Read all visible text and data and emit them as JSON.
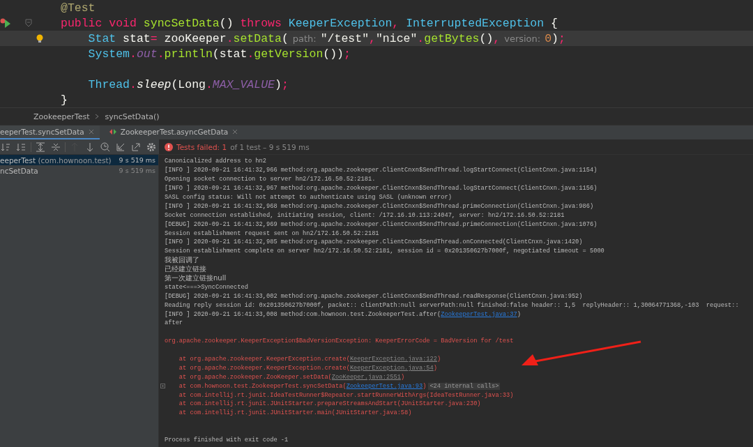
{
  "editor": {
    "lines": [
      {
        "current": false,
        "kind": "plain",
        "tokens": [
          {
            "t": "@Test",
            "kind": "annotation"
          }
        ]
      },
      {
        "current": false,
        "kind": "run",
        "tokens": [
          {
            "t": "public void ",
            "kind": "keyword"
          },
          {
            "t": "syncSetData",
            "kind": "method"
          },
          {
            "t": "() ",
            "kind": "plain"
          },
          {
            "t": "throws ",
            "kind": "keyword"
          },
          {
            "t": "KeeperException",
            "kind": "type"
          },
          {
            "t": ", ",
            "kind": "op"
          },
          {
            "t": "InterruptedException",
            "kind": "type"
          },
          {
            "t": " {",
            "kind": "plain"
          }
        ],
        "children": [
          {
            "current": true,
            "kind": "bulb",
            "tokens": [
              {
                "t": "Stat",
                "kind": "type"
              },
              {
                "t": " stat",
                "kind": "plain"
              },
              {
                "t": "=",
                "kind": "op"
              },
              {
                "t": " zooKeeper",
                "kind": "plain"
              },
              {
                "t": ".",
                "kind": "op"
              },
              {
                "t": "setData",
                "kind": "method"
              },
              {
                "t": "(",
                "kind": "plain"
              },
              {
                "t": "path:",
                "kind": "hint"
              },
              {
                "t": "\"/test\"",
                "kind": "string"
              },
              {
                "t": ",",
                "kind": "op"
              },
              {
                "t": "\"nice\"",
                "kind": "string"
              },
              {
                "t": ".",
                "kind": "op"
              },
              {
                "t": "getBytes",
                "kind": "method"
              },
              {
                "t": "()",
                "kind": "plain"
              },
              {
                "t": ",",
                "kind": "op"
              },
              {
                "t": "version:",
                "kind": "hint"
              },
              {
                "t": "0",
                "kind": "number"
              },
              {
                "t": ")",
                "kind": "plain"
              },
              {
                "t": ";",
                "kind": "op"
              }
            ]
          },
          {
            "current": false,
            "kind": "plain",
            "tokens": [
              {
                "t": "System",
                "kind": "type"
              },
              {
                "t": ".",
                "kind": "op"
              },
              {
                "t": "out",
                "kind": "field"
              },
              {
                "t": ".",
                "kind": "op"
              },
              {
                "t": "println",
                "kind": "method"
              },
              {
                "t": "(stat",
                "kind": "plain"
              },
              {
                "t": ".",
                "kind": "op"
              },
              {
                "t": "getVersion",
                "kind": "method"
              },
              {
                "t": "())",
                "kind": "plain"
              },
              {
                "t": ";",
                "kind": "op"
              }
            ]
          },
          {
            "current": false,
            "kind": "plain"
          },
          {
            "current": false,
            "kind": "plain",
            "tokens": [
              {
                "t": "Thread",
                "kind": "type"
              },
              {
                "t": ".",
                "kind": "op"
              },
              {
                "t": "sleep",
                "kind": "static"
              },
              {
                "t": "(Long",
                "kind": "plain"
              },
              {
                "t": ".",
                "kind": "op"
              },
              {
                "t": "MAX_VALUE",
                "kind": "field"
              },
              {
                "t": ")",
                "kind": "plain"
              },
              {
                "t": ";",
                "kind": "op"
              }
            ]
          }
        ]
      },
      {
        "current": false,
        "kind": "plain",
        "tokens": [
          {
            "t": "}",
            "kind": "plain"
          }
        ]
      }
    ]
  },
  "breadcrumbs": [
    "ZookeeperTest",
    "syncSetData()"
  ],
  "run_tabs": [
    {
      "label": "eeperTest.syncSetData",
      "selected": true
    },
    {
      "label": "ZookeeperTest.asyncGetData",
      "selected": false
    }
  ],
  "toolbar": [
    {
      "kind": "sort-alpha",
      "disabled": false
    },
    {
      "kind": "sort-duration",
      "disabled": false
    },
    {
      "kind": "expand",
      "disabled": false
    },
    {
      "kind": "collapse",
      "disabled": false
    },
    {
      "kind": "up",
      "disabled": true
    },
    {
      "kind": "down",
      "disabled": false
    },
    {
      "kind": "history",
      "disabled": false
    },
    {
      "kind": "import",
      "disabled": false
    },
    {
      "kind": "export",
      "disabled": false
    },
    {
      "kind": "settings",
      "disabled": false
    }
  ],
  "test_status": {
    "failed": "Tests failed: 1",
    "rest": "of 1 test – 9 s 519 ms"
  },
  "test_tree": [
    {
      "name": "eeperTest",
      "package": "(com.hownoon.test)",
      "time": "9 s 519 ms",
      "selected": true,
      "children": [
        {
          "name": "ncSetData",
          "time": "9 s 519 ms",
          "selected": false
        }
      ]
    }
  ],
  "console": [
    {
      "kind": "out",
      "segments": [
        {
          "t": "Canonicalized address to hn2",
          "kind": "text"
        }
      ]
    },
    {
      "kind": "out",
      "segments": [
        {
          "t": "[INFO ] 2020-09-21 16:41:32,966 method:org.apache.zookeeper.ClientCnxn$SendThread.logStartConnect(ClientCnxn.java:1154)",
          "kind": "text"
        }
      ]
    },
    {
      "kind": "out",
      "segments": [
        {
          "t": "Opening socket connection to server hn2/172.16.50.52:2181.",
          "kind": "text"
        }
      ]
    },
    {
      "kind": "out",
      "segments": [
        {
          "t": "[INFO ] 2020-09-21 16:41:32,967 method:org.apache.zookeeper.ClientCnxn$SendThread.logStartConnect(ClientCnxn.java:1156)",
          "kind": "text"
        }
      ]
    },
    {
      "kind": "out",
      "segments": [
        {
          "t": "SASL config status: Will not attempt to authenticate using SASL (unknown error)",
          "kind": "text"
        }
      ]
    },
    {
      "kind": "out",
      "segments": [
        {
          "t": "[INFO ] 2020-09-21 16:41:32,968 method:org.apache.zookeeper.ClientCnxn$SendThread.primeConnection(ClientCnxn.java:986)",
          "kind": "text"
        }
      ]
    },
    {
      "kind": "out",
      "segments": [
        {
          "t": "Socket connection established, initiating session, client: /172.16.10.113:24047, server: hn2/172.16.50.52:2181",
          "kind": "text"
        }
      ]
    },
    {
      "kind": "out",
      "segments": [
        {
          "t": "[DEBUG] 2020-09-21 16:41:32,969 method:org.apache.zookeeper.ClientCnxn$SendThread.primeConnection(ClientCnxn.java:1076)",
          "kind": "text"
        }
      ]
    },
    {
      "kind": "out",
      "segments": [
        {
          "t": "Session establishment request sent on hn2/172.16.50.52:2181",
          "kind": "text"
        }
      ]
    },
    {
      "kind": "out",
      "segments": [
        {
          "t": "[INFO ] 2020-09-21 16:41:32,985 method:org.apache.zookeeper.ClientCnxn$SendThread.onConnected(ClientCnxn.java:1420)",
          "kind": "text"
        }
      ]
    },
    {
      "kind": "out",
      "segments": [
        {
          "t": "Session establishment complete on server hn2/172.16.50.52:2181, session id = 0x201350627b7000f, negotiated timeout = 5000",
          "kind": "text"
        }
      ]
    },
    {
      "kind": "out",
      "segments": [
        {
          "t": "我被回调了",
          "kind": "text"
        }
      ]
    },
    {
      "kind": "out",
      "segments": [
        {
          "t": "已经建立链接",
          "kind": "text"
        }
      ]
    },
    {
      "kind": "out",
      "segments": [
        {
          "t": "第一次建立链接null",
          "kind": "text"
        }
      ]
    },
    {
      "kind": "out",
      "segments": [
        {
          "t": "state<===>SyncConnected",
          "kind": "text"
        }
      ]
    },
    {
      "kind": "out",
      "segments": [
        {
          "t": "[DEBUG] 2020-09-21 16:41:33,002 method:org.apache.zookeeper.ClientCnxn$SendThread.readResponse(ClientCnxn.java:952)",
          "kind": "text"
        }
      ]
    },
    {
      "kind": "out",
      "segments": [
        {
          "t": "Reading reply session id: 0x201350627b7000f, packet:: clientPath:null serverPath:null finished:false header:: 1,5  replyHeader:: 1,30064771368,-103  request::",
          "kind": "text"
        }
      ]
    },
    {
      "kind": "out",
      "segments": [
        {
          "t": "[INFO ] 2020-09-21 16:41:33,008 method:com.hownoon.test.ZookeeperTest.after(",
          "kind": "text"
        },
        {
          "t": "ZookeeperTest.java:37",
          "kind": "link"
        },
        {
          "t": ")",
          "kind": "text"
        }
      ]
    },
    {
      "kind": "out",
      "segments": [
        {
          "t": "after",
          "kind": "text"
        }
      ]
    },
    {
      "kind": "blank"
    },
    {
      "kind": "error",
      "segments": [
        {
          "t": "org.apache.zookeeper.KeeperException$BadVersionException: KeeperErrorCode = BadVersion for /test",
          "kind": "text"
        }
      ]
    },
    {
      "kind": "blank"
    },
    {
      "kind": "error",
      "segments": [
        {
          "t": "    at org.apache.zookeeper.KeeperException.create(",
          "kind": "text"
        },
        {
          "t": "KeeperException.java:122",
          "kind": "muted-link"
        },
        {
          "t": ")",
          "kind": "text"
        }
      ]
    },
    {
      "kind": "error",
      "segments": [
        {
          "t": "    at org.apache.zookeeper.KeeperException.create(",
          "kind": "text"
        },
        {
          "t": "KeeperException.java:54",
          "kind": "muted-link"
        },
        {
          "t": ")",
          "kind": "text"
        }
      ]
    },
    {
      "kind": "error",
      "segments": [
        {
          "t": "    at org.apache.zookeeper.ZooKeeper.setData(",
          "kind": "text"
        },
        {
          "t": "ZooKeeper.java:2551",
          "kind": "muted-link"
        },
        {
          "t": ")",
          "kind": "text"
        }
      ]
    },
    {
      "kind": "error",
      "fold": true,
      "segments": [
        {
          "t": "    at com.hownoon.test.ZookeeperTest.syncSetData(",
          "kind": "text"
        },
        {
          "t": "ZookeeperTest.java:93",
          "kind": "link"
        },
        {
          "t": ")",
          "kind": "text"
        },
        {
          "t": "<24 internal calls>",
          "kind": "folded"
        }
      ]
    },
    {
      "kind": "error",
      "segments": [
        {
          "t": "    at com.intellij.rt.junit.IdeaTestRunner$Repeater.startRunnerWithArgs(IdeaTestRunner.java:33)",
          "kind": "text"
        }
      ]
    },
    {
      "kind": "error",
      "segments": [
        {
          "t": "    at com.intellij.rt.junit.JUnitStarter.prepareStreamsAndStart(JUnitStarter.java:230)",
          "kind": "text"
        }
      ]
    },
    {
      "kind": "error",
      "segments": [
        {
          "t": "    at com.intellij.rt.junit.JUnitStarter.main(JUnitStarter.java:58)",
          "kind": "text"
        }
      ]
    },
    {
      "kind": "blank"
    },
    {
      "kind": "blank"
    },
    {
      "kind": "out",
      "segments": [
        {
          "t": "Process finished with exit code -1",
          "kind": "text"
        }
      ]
    }
  ]
}
